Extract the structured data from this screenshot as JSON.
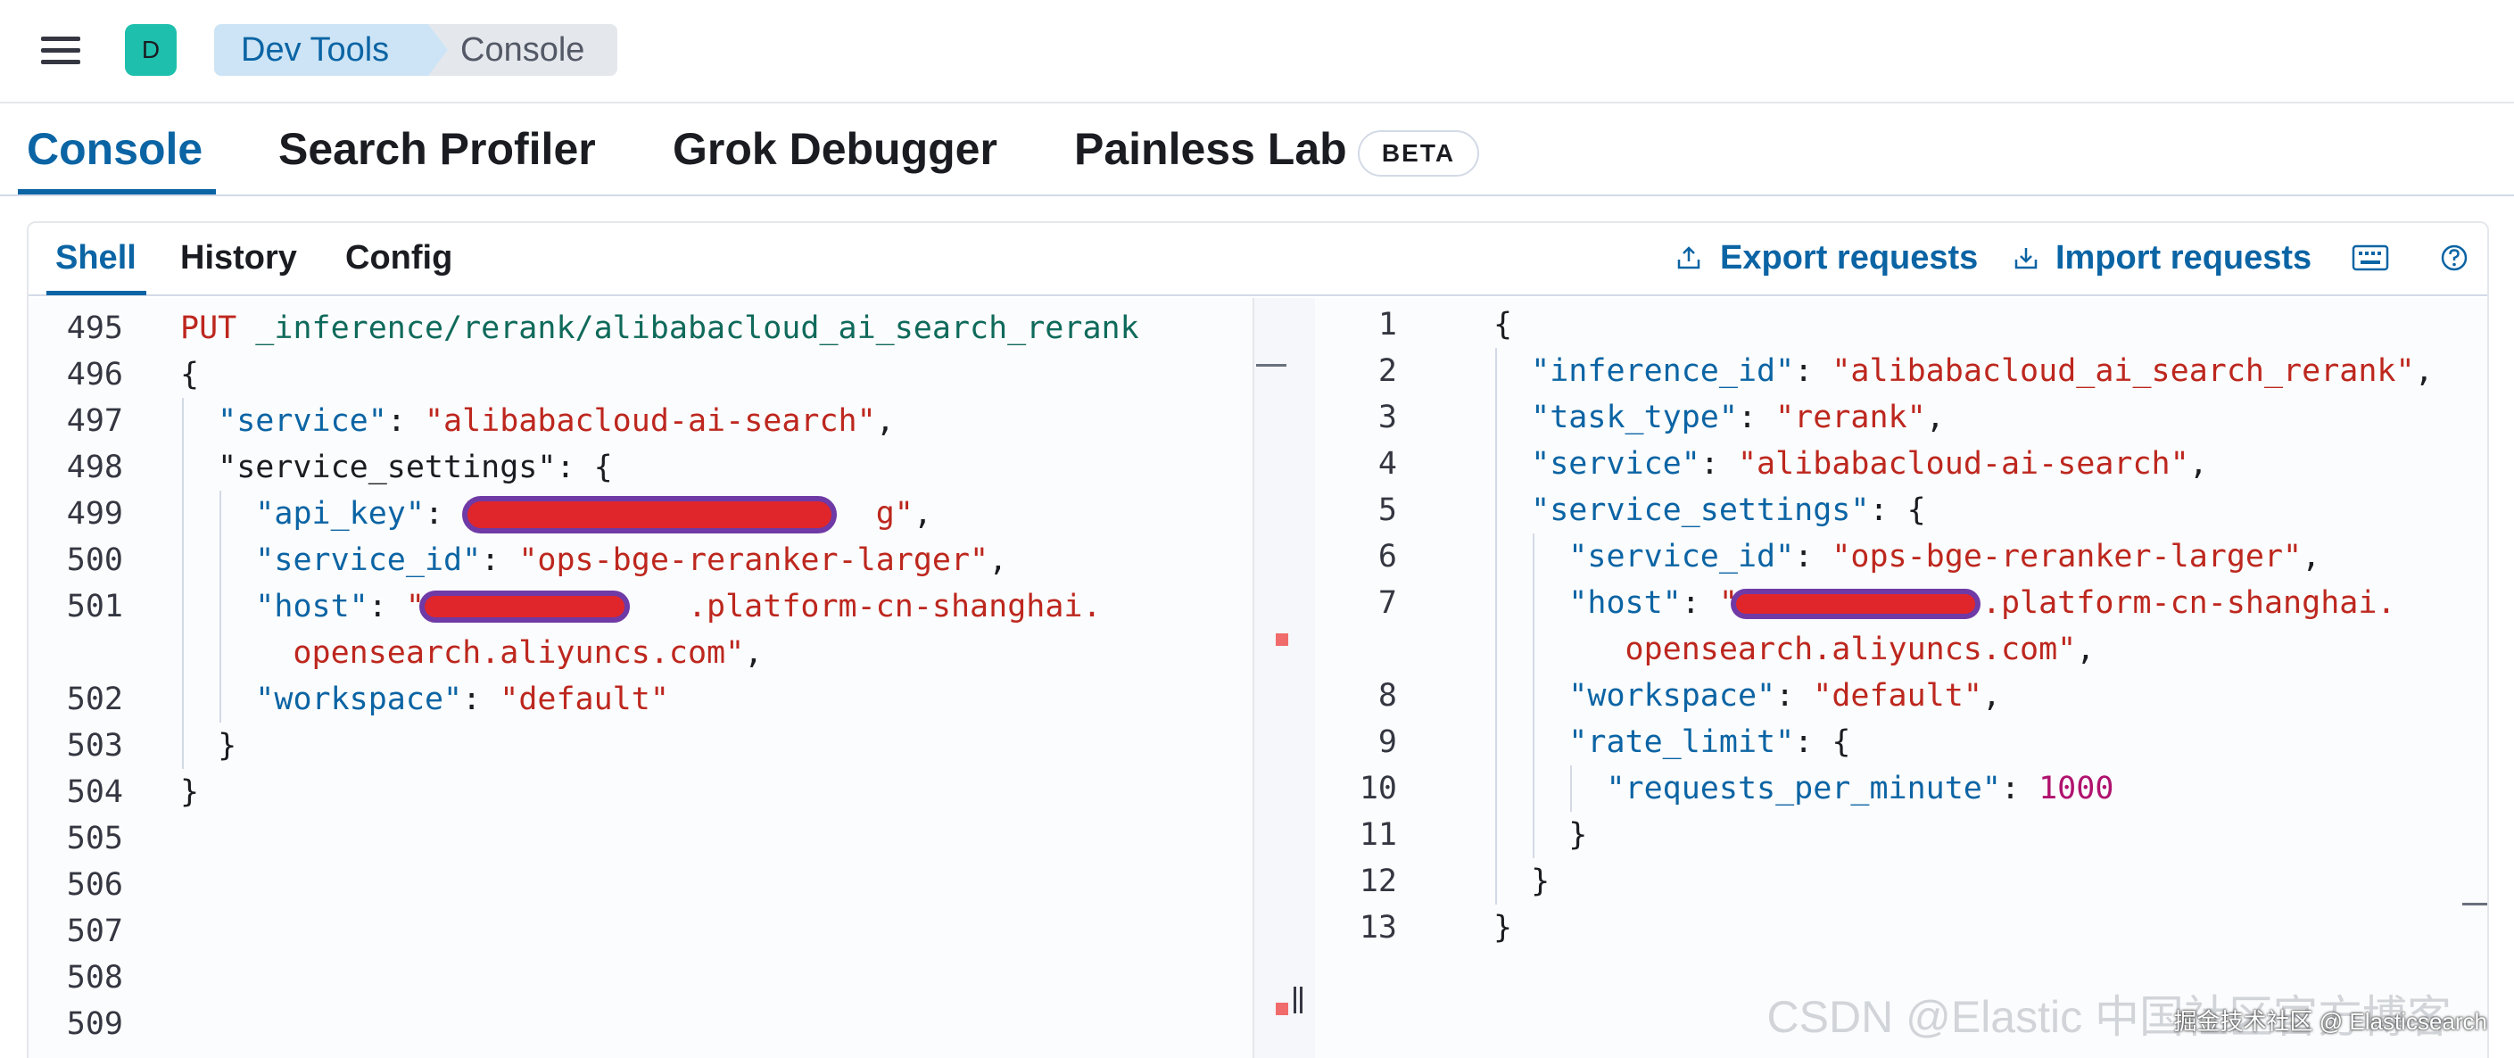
{
  "header": {
    "space_initial": "D",
    "breadcrumbs": [
      "Dev Tools",
      "Console"
    ]
  },
  "main_tabs": [
    {
      "label": "Console",
      "active": true
    },
    {
      "label": "Search Profiler",
      "active": false
    },
    {
      "label": "Grok Debugger",
      "active": false
    },
    {
      "label": "Painless Lab",
      "active": false
    }
  ],
  "beta_label": "BETA",
  "sub_tabs": [
    {
      "label": "Shell",
      "active": true
    },
    {
      "label": "History",
      "active": false
    },
    {
      "label": "Config",
      "active": false
    }
  ],
  "actions": {
    "export_label": "Export requests",
    "import_label": "Import requests"
  },
  "icons": {
    "menu": "hamburger-menu-icon",
    "export": "upload-icon",
    "import": "download-icon",
    "keyboard": "keyboard-icon",
    "help": "help-circle-icon"
  },
  "colors": {
    "accent": "#0b64a4",
    "key": "#0b64a4",
    "string": "#bd271e",
    "number": "#b0126e",
    "avatar": "#1fbfad"
  },
  "request_editor": {
    "lines": [
      {
        "num": "495",
        "text": "PUT _inference/rerank/alibabacloud_ai_search_rerank"
      },
      {
        "num": "496",
        "text": "{"
      },
      {
        "num": "497",
        "text": "  \"service\": \"alibabacloud-ai-search\","
      },
      {
        "num": "498",
        "text": "  \"service_settings\": {"
      },
      {
        "num": "499",
        "text": "    \"api_key\": \"                     g\","
      },
      {
        "num": "500",
        "text": "    \"service_id\": \"ops-bge-reranker-larger\","
      },
      {
        "num": "501",
        "text": "    \"host\": \"              .platform-cn-shanghai."
      },
      {
        "num": "",
        "text": "      opensearch.aliyuncs.com\","
      },
      {
        "num": "502",
        "text": "    \"workspace\": \"default\""
      },
      {
        "num": "503",
        "text": "  }"
      },
      {
        "num": "504",
        "text": "}"
      },
      {
        "num": "505",
        "text": ""
      },
      {
        "num": "506",
        "text": ""
      },
      {
        "num": "507",
        "text": ""
      },
      {
        "num": "508",
        "text": ""
      },
      {
        "num": "509",
        "text": ""
      }
    ]
  },
  "response_editor": {
    "lines": [
      {
        "num": "1",
        "text": "{"
      },
      {
        "num": "2",
        "text": "  \"inference_id\": \"alibabacloud_ai_search_rerank\","
      },
      {
        "num": "3",
        "text": "  \"task_type\": \"rerank\","
      },
      {
        "num": "4",
        "text": "  \"service\": \"alibabacloud-ai-search\","
      },
      {
        "num": "5",
        "text": "  \"service_settings\": {"
      },
      {
        "num": "6",
        "text": "    \"service_id\": \"ops-bge-reranker-larger\","
      },
      {
        "num": "7",
        "text": "    \"host\": \"             .platform-cn-shanghai."
      },
      {
        "num": "",
        "text": "       opensearch.aliyuncs.com\","
      },
      {
        "num": "8",
        "text": "    \"workspace\": \"default\","
      },
      {
        "num": "9",
        "text": "    \"rate_limit\": {"
      },
      {
        "num": "10",
        "text": "      \"requests_per_minute\": 1000"
      },
      {
        "num": "11",
        "text": "    }"
      },
      {
        "num": "12",
        "text": "  }"
      },
      {
        "num": "13",
        "text": "}"
      }
    ]
  },
  "watermark": "CSDN @Elastic 中国社区官方博客",
  "watermark_small": "掘金技术社区 @ Elasticsearch"
}
